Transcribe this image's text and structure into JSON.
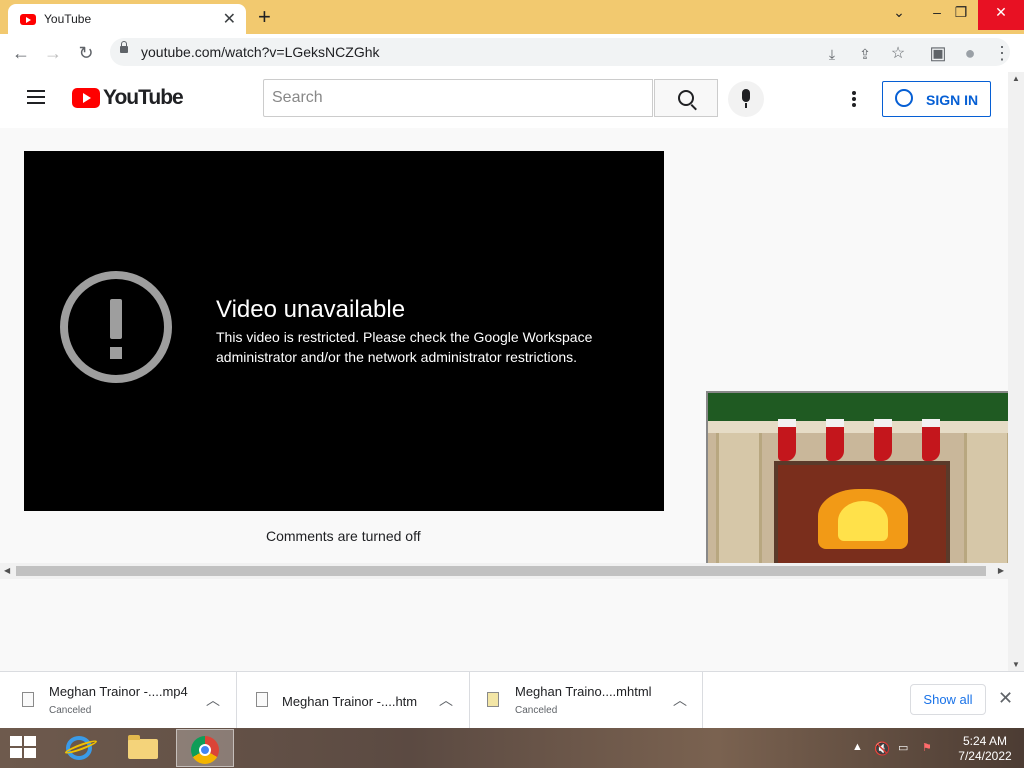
{
  "browser": {
    "tab_title": "YouTube",
    "tab_close": "✕",
    "new_tab": "+",
    "url": "youtube.com/watch?v=LGeksNCZGhk",
    "window_controls": {
      "dropdown": "⌄",
      "minimize": "–",
      "restore": "❐",
      "close": "✕"
    }
  },
  "toolbar_icons": {
    "back": "←",
    "forward": "→",
    "reload": "↻",
    "install": "⤓",
    "share": "⇪",
    "bookmark": "☆",
    "sidepanel": "▣",
    "profile": "●",
    "menu": "⋮"
  },
  "youtube": {
    "logo_text": "YouTube",
    "search_placeholder": "Search",
    "sign_in": "SIGN IN"
  },
  "player": {
    "title": "Video unavailable",
    "message": "This video is restricted. Please check the Google Workspace administrator and/or the network administrator restrictions."
  },
  "comments_text": "Comments are turned off",
  "downloads": {
    "items": [
      {
        "name": "Meghan Trainor -....mp4",
        "status": "Canceled"
      },
      {
        "name": "Meghan Trainor -....htm",
        "status": ""
      },
      {
        "name": "Meghan Traino....mhtml",
        "status": "Canceled"
      }
    ],
    "show_all": "Show all",
    "close": "✕"
  },
  "taskbar": {
    "apps": [
      "internet-explorer",
      "file-explorer",
      "chrome"
    ],
    "tray": {
      "arrow": "▲",
      "time": "5:24 AM",
      "date": "7/24/2022"
    }
  },
  "colors": {
    "tab_strip": "#f2c96f",
    "youtube_red": "#ff0000",
    "sign_in_blue": "#065fd4",
    "player_bg": "#000000"
  }
}
